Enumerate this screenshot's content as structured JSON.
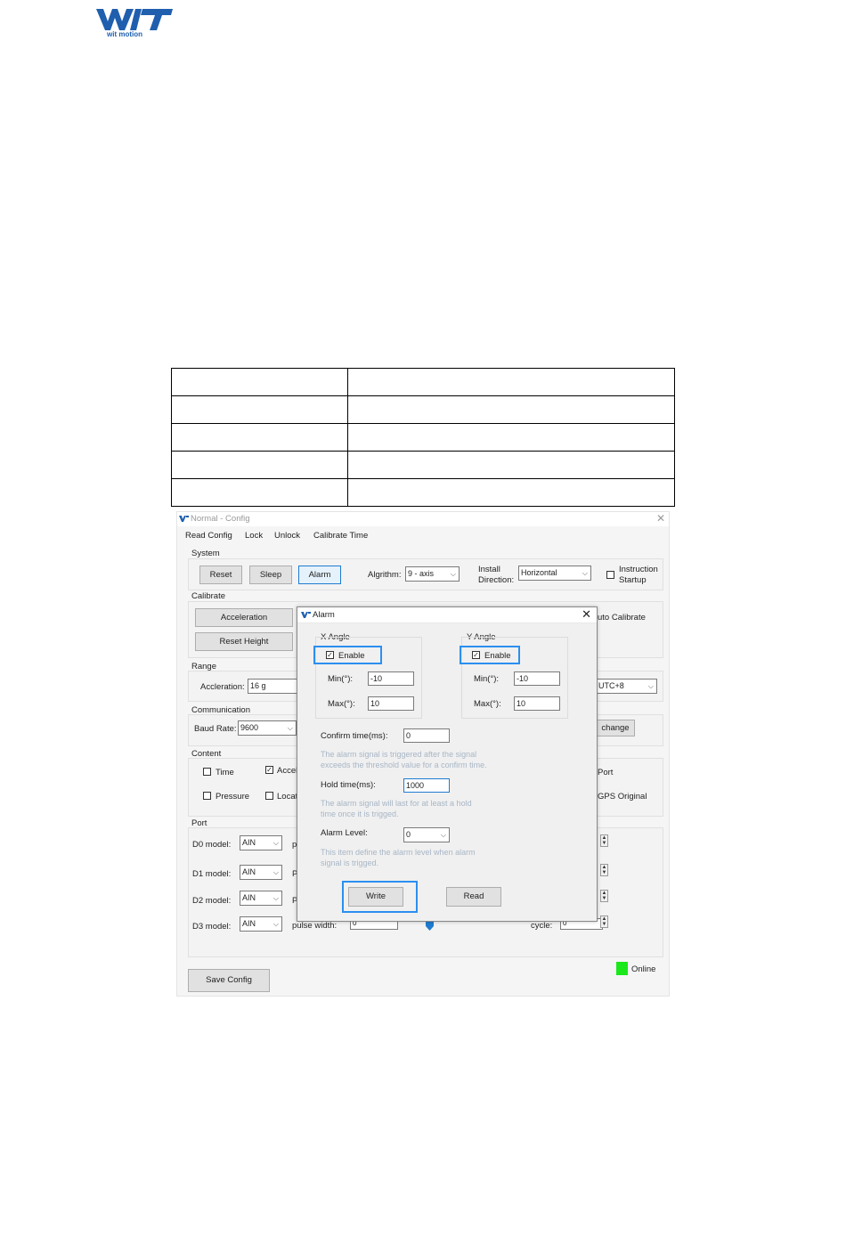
{
  "logo": {
    "text": "wit motion",
    "brand_color": "#1f5fae"
  },
  "doc_table": {
    "rows": 5,
    "cols": 2
  },
  "window": {
    "title": "Normal - Config",
    "menu": [
      "Read Config",
      "Lock",
      "Unlock",
      "Calibrate Time"
    ],
    "system": {
      "label": "System",
      "buttons": [
        "Reset",
        "Sleep",
        "Alarm"
      ],
      "algorithm_label": "Algrithm:",
      "algorithm_value": "9 - axis",
      "install_label_1": "Install",
      "install_label_2": "Direction:",
      "install_value": "Horizontal",
      "instruction_label_1": "Instruction",
      "instruction_label_2": "Startup"
    },
    "calibrate": {
      "label": "Calibrate",
      "buttons": [
        "Acceleration",
        "Reset Height"
      ],
      "auto_label": "uto Calibrate"
    },
    "range": {
      "label": "Range",
      "accel_label": "Accleration:",
      "accel_value": "16 g",
      "tz_value": "UTC+8"
    },
    "communication": {
      "label": "Communication",
      "baud_label": "Baud Rate:",
      "baud_value": "9600",
      "change_label": "change"
    },
    "content": {
      "label": "Content",
      "time": "Time",
      "accel": "Accel",
      "pressure": "Pressure",
      "locat": "Locat",
      "port": "Port",
      "gps_original": "GPS Original"
    },
    "port": {
      "label": "Port",
      "rows": [
        {
          "label": "D0 model:",
          "value": "AIN",
          "p": "p"
        },
        {
          "label": "D1 model:",
          "value": "AIN",
          "p": "P"
        },
        {
          "label": "D2 model:",
          "value": "AIN",
          "p": "P"
        },
        {
          "label": "D3 model:",
          "value": "AIN",
          "p": "pulse width:"
        }
      ],
      "pulse_value": "0",
      "cycle_label": "cycle:",
      "cycle_value": "0"
    },
    "save_config": "Save Config",
    "status": "Online",
    "status_color": "#1ae81a"
  },
  "alarm": {
    "title": "Alarm",
    "x_angle": {
      "label": "X Angle",
      "enable": "Enable",
      "min_label": "Min(°):",
      "min_value": "-10",
      "max_label": "Max(°):",
      "max_value": "10"
    },
    "y_angle": {
      "label": "Y Angle",
      "enable": "Enable",
      "min_label": "Min(°):",
      "min_value": "-10",
      "max_label": "Max(°):",
      "max_value": "10"
    },
    "confirm_label": "Confirm time(ms):",
    "confirm_value": "0",
    "confirm_hint_1": "The alarm signal is triggered after the signal",
    "confirm_hint_2": "exceeds the threshold value for a confirm time.",
    "hold_label": "Hold time(ms):",
    "hold_value": "1000",
    "hold_hint_1": "The alarm signal will last for at least a hold",
    "hold_hint_2": "time once it is trigged.",
    "level_label": "Alarm Level:",
    "level_value": "0",
    "level_hint_1": "This item define the alarm level when alarm",
    "level_hint_2": "signal is trigged.",
    "write": "Write",
    "read": "Read"
  }
}
